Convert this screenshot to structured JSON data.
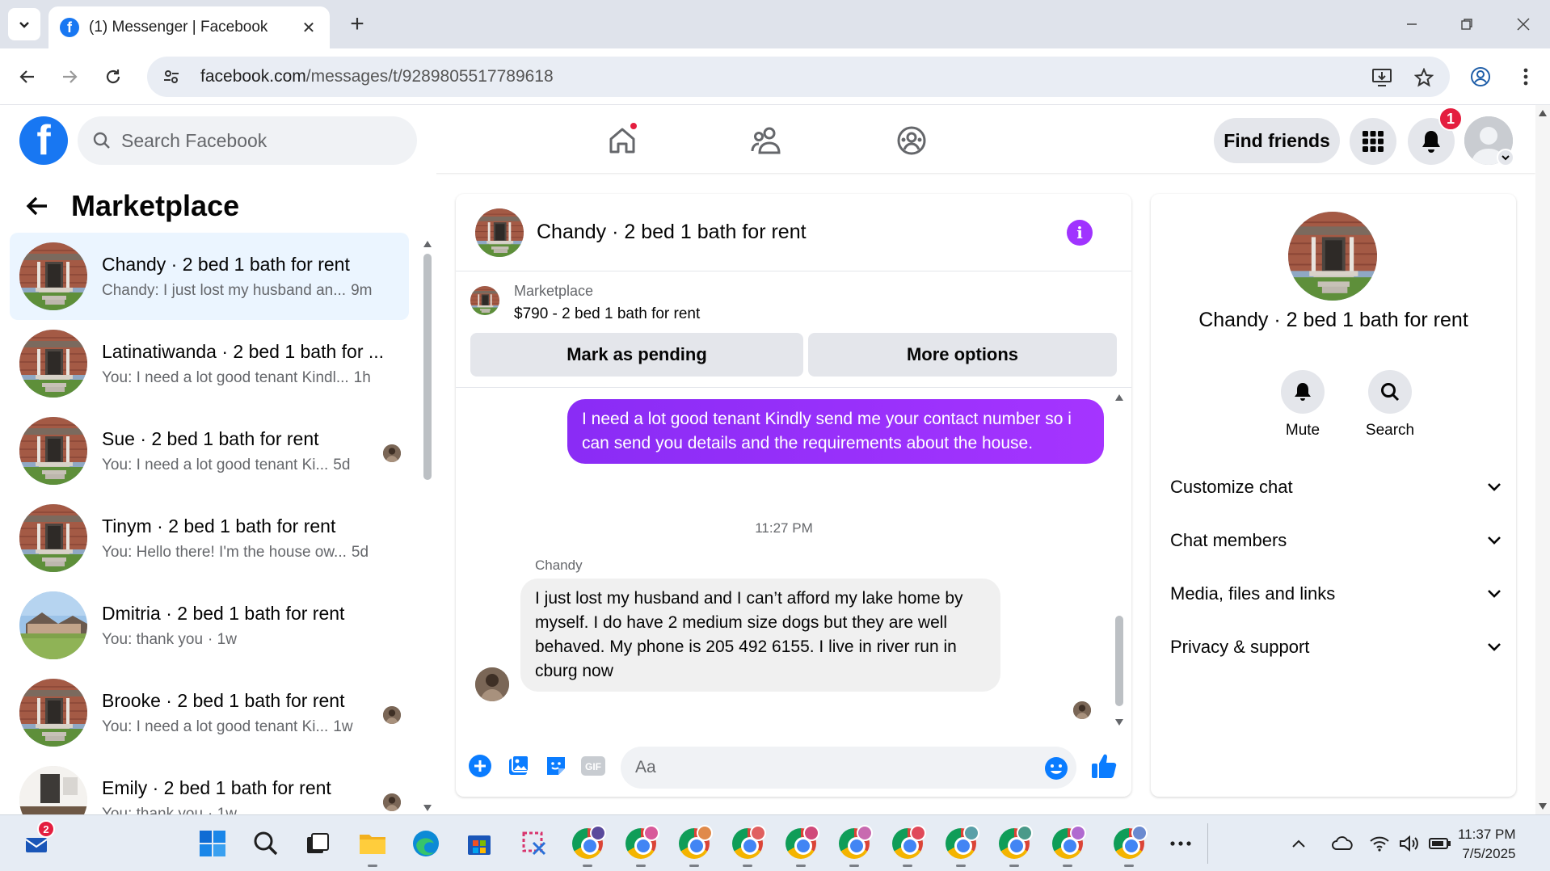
{
  "browser": {
    "tab_title": "(1) Messenger | Facebook",
    "url_host": "facebook.com",
    "url_path": "/messages/t/9289805517789618"
  },
  "header": {
    "search_placeholder": "Search Facebook",
    "find_friends": "Find friends",
    "notification_count": "1",
    "brand_color": "#1877f2"
  },
  "left": {
    "title": "Marketplace",
    "conversations": [
      {
        "name": "Chandy · 2 bed 1 bath for rent",
        "snippet": "Chandy: I just lost my husband an...",
        "time": "9m",
        "active": true,
        "avatar": "porch"
      },
      {
        "name": "Latinatiwanda · 2 bed 1 bath for ...",
        "snippet": "You: I need a lot good tenant Kindl...",
        "time": "1h",
        "avatar": "porch"
      },
      {
        "name": "Sue · 2 bed 1 bath for rent",
        "snippet": "You: I need a lot good tenant Ki...",
        "time": "5d",
        "avatar": "porch"
      },
      {
        "name": "Tinym · 2 bed 1 bath for rent",
        "snippet": "You: Hello there! I'm the house ow...",
        "time": "5d",
        "avatar": "porch"
      },
      {
        "name": "Dmitria · 2 bed 1 bath for rent",
        "snippet": "You: thank you",
        "time": "· 1w",
        "avatar": "house"
      },
      {
        "name": "Brooke · 2 bed 1 bath for rent",
        "snippet": "You: I need a lot good tenant Ki...",
        "time": "1w",
        "avatar": "porch"
      },
      {
        "name": "Emily · 2 bed 1 bath for rent",
        "snippet": "You: thank you",
        "time": "· 1w",
        "avatar": "interior"
      }
    ]
  },
  "chat": {
    "title": "Chandy · 2 bed 1 bath for rent",
    "listing_label": "Marketplace",
    "listing_price": "$790 - 2 bed 1 bath for rent",
    "mark_pending": "Mark as pending",
    "more_options": "More options",
    "outgoing_message": "I need a lot good tenant Kindly send me your contact number so i can send you details and the requirements about the house.",
    "timestamp": "11:27 PM",
    "sender": "Chandy",
    "incoming_message": "I just lost my husband and I can’t afford my lake home by myself. I do have 2 medium size dogs but they are well behaved. My phone is 205 492 6155. I live in river run in cburg now",
    "composer_placeholder": "Aa",
    "outgoing_color": "#a033ff"
  },
  "info": {
    "name": "Chandy · 2 bed 1 bath for rent",
    "mute": "Mute",
    "search": "Search",
    "sections": [
      "Customize chat",
      "Chat members",
      "Media, files and links",
      "Privacy & support"
    ]
  },
  "taskbar": {
    "mail_badge": "2",
    "time": "11:37 PM",
    "date": "7/5/2025"
  }
}
